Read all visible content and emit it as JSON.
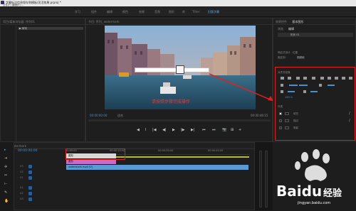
{
  "titlebar": {
    "title": "字幕标注信息保存到模板/灵活效果.prproj *",
    "menu": "文件(F)  编辑(E) ..."
  },
  "workspaces": [
    "学习",
    "组件",
    "编辑",
    "颜色",
    "效果",
    "音频",
    "图形",
    "库",
    "Titler",
    "旧版字幕"
  ],
  "active_workspace_index": 9,
  "left_panel": {
    "title": "项目/媒体浏览器: 序列01",
    "items": [
      "▶ 序列"
    ]
  },
  "program": {
    "title": "节目: 序列_ watermark",
    "timecode_left": "00:00:00:00",
    "fit_label": "适合",
    "timecode_right": "00:00:46:15",
    "overlay_text": "请按照步骤完成操作"
  },
  "transport": [
    "◀",
    "I",
    "|◀",
    "◀|",
    "▶",
    "|▶",
    "▶|",
    "⏮",
    "⏭",
    "📷",
    "⊞",
    "+"
  ],
  "right_panel": {
    "tabs": [
      "效果控件",
      "基本图形"
    ],
    "sub_tabs": [
      "浏览",
      "编辑"
    ],
    "item_label": "形状 01",
    "align_label": "响应式设计 - 位置",
    "pin_label": "固定到:",
    "pin_value": "视频帧",
    "sections": {
      "align": "对齐并变换",
      "appearance": "外观"
    },
    "percent": "100 %",
    "fill_label": "填充",
    "stroke_label": "描边",
    "shadow_label": "阴影",
    "fill_color": "#ffffff",
    "stroke_color": "#ffffff",
    "shadow_color": "#000000"
  },
  "timeline": {
    "title": "序列_ watermark",
    "timecode": "00:00:00:00",
    "ruler": [
      "00:00:00",
      "00:00:15:00",
      "00:00:30:00",
      "00:00:45:00"
    ],
    "tracks": [
      "V3",
      "V2",
      "V1",
      "A1",
      "A2",
      "A3"
    ],
    "clips": [
      {
        "label": "图形",
        "color": "#d8d8d8"
      },
      {
        "label": "图形",
        "color": "#c86ac8"
      },
      {
        "label": "watermark.mp4 [V]",
        "color": "#5b9bd5"
      }
    ]
  },
  "watermark": {
    "logo": "Baidu",
    "text": "经验",
    "url": "jingyan.baidu.com"
  },
  "colors": {
    "accent": "#5aa7e8",
    "annotation": "#e02020"
  }
}
